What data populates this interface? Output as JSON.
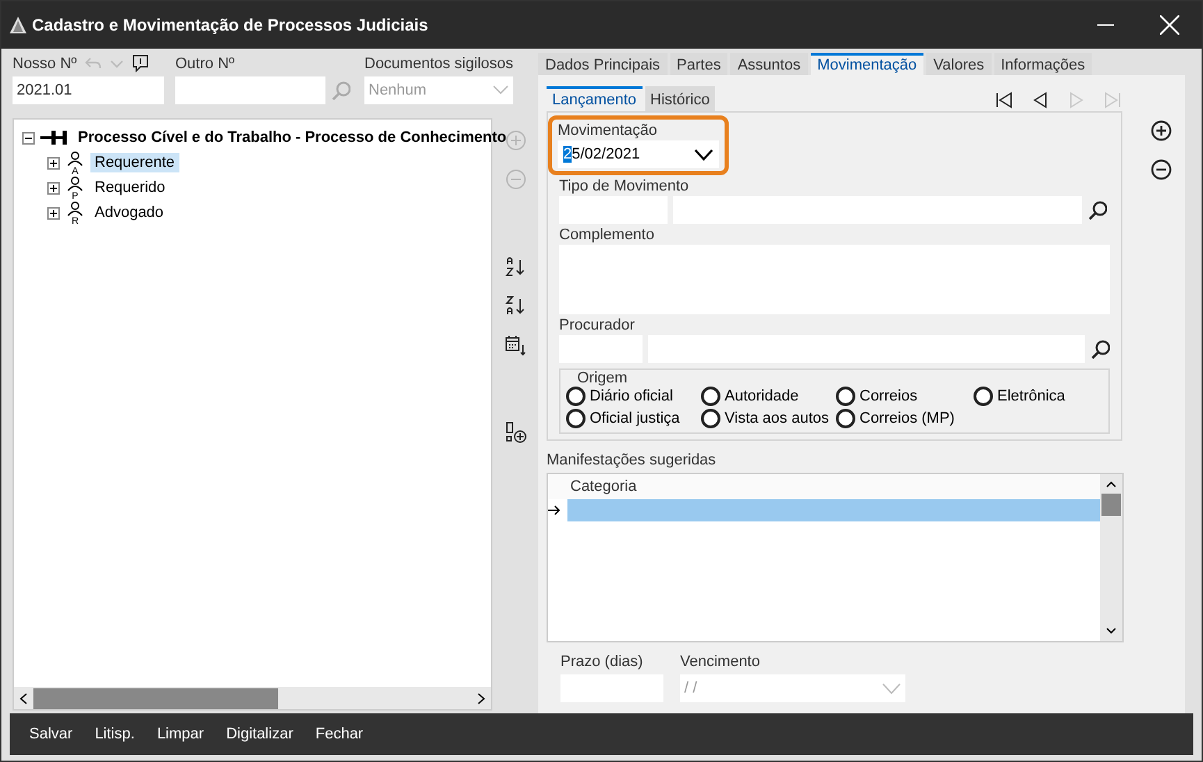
{
  "window": {
    "title": "Cadastro e Movimentação de Processos Judiciais"
  },
  "header": {
    "nosso_label": "Nosso Nº",
    "nosso_value": "2021.01",
    "outro_label": "Outro Nº",
    "docs_label": "Documentos sigilosos",
    "docs_value": "Nenhum"
  },
  "tree": {
    "label": "Processo Cível e do Trabalho - Processo de Conhecimento",
    "expanded": true,
    "children": [
      {
        "label": "Requerente",
        "icon_letter": "A",
        "selected": true,
        "expanded": false
      },
      {
        "label": "Requerido",
        "icon_letter": "P",
        "selected": false,
        "expanded": false
      },
      {
        "label": "Advogado",
        "icon_letter": "R",
        "selected": false,
        "expanded": false
      }
    ]
  },
  "tree_tools": [
    {
      "kind": "add",
      "disabled": true
    },
    {
      "kind": "remove",
      "disabled": true
    },
    {
      "kind": "sort-az",
      "disabled": false
    },
    {
      "kind": "sort-za",
      "disabled": false
    },
    {
      "kind": "sort-date",
      "disabled": false
    },
    {
      "kind": "add-item",
      "disabled": false
    }
  ],
  "tabs": [
    {
      "label": "Dados Principais",
      "selected": false
    },
    {
      "label": "Partes",
      "selected": false
    },
    {
      "label": "Assuntos",
      "selected": false
    },
    {
      "label": "Movimentação",
      "selected": true
    },
    {
      "label": "Valores",
      "selected": false
    },
    {
      "label": "Informações",
      "selected": false
    }
  ],
  "subtabs": [
    {
      "label": "Lançamento",
      "selected": true
    },
    {
      "label": "Histórico",
      "selected": false
    }
  ],
  "nav": [
    {
      "kind": "first",
      "disabled": false
    },
    {
      "kind": "prev",
      "disabled": false
    },
    {
      "kind": "next",
      "disabled": true
    },
    {
      "kind": "last",
      "disabled": true
    }
  ],
  "form": {
    "movimentacao": {
      "label": "Movimentação",
      "value": "25/02/2021",
      "highlighted": true
    },
    "tipo_label": "Tipo de Movimento",
    "complemento_label": "Complemento",
    "procurador_label": "Procurador",
    "origem": {
      "legend": "Origem",
      "options": [
        {
          "label": "Diário oficial",
          "selected": false
        },
        {
          "label": "Autoridade",
          "selected": false
        },
        {
          "label": "Correios",
          "selected": false
        },
        {
          "label": "Eletrônica",
          "selected": false
        },
        {
          "label": "Oficial justiça",
          "selected": false
        },
        {
          "label": "Vista aos autos",
          "selected": false
        },
        {
          "label": "Correios (MP)",
          "selected": false
        }
      ]
    }
  },
  "manifestacoes": {
    "label": "Manifestações sugeridas",
    "columns": [
      "Categoria"
    ],
    "rows": [
      {
        "selected": true
      }
    ]
  },
  "prazo": {
    "label": "Prazo (dias)"
  },
  "vencimento": {
    "label": "Vencimento",
    "placeholder": "/ /"
  },
  "footer_buttons": [
    "Salvar",
    "Litisp.",
    "Limpar",
    "Digitalizar",
    "Fechar"
  ]
}
